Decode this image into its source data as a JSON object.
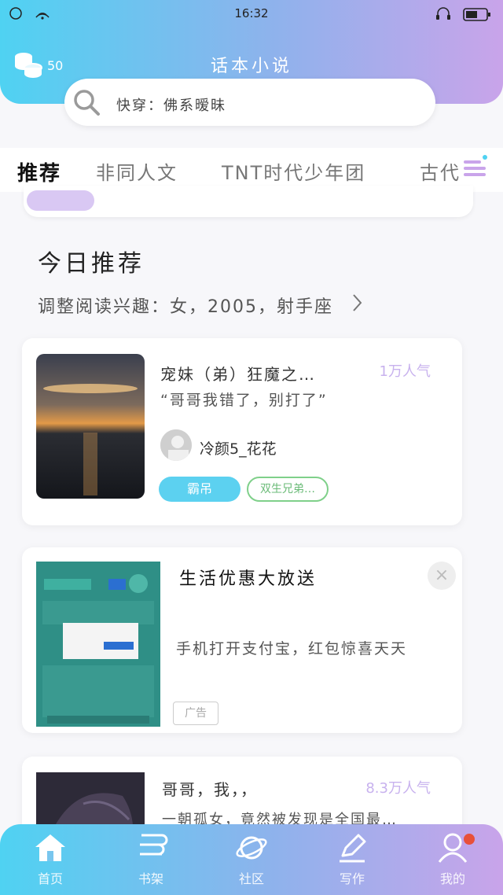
{
  "status_bar": {
    "time": "16:32"
  },
  "header": {
    "coin_count": "50",
    "app_title": "话本小说",
    "search_value": "快穿：佛系暧昧"
  },
  "tabs": [
    {
      "label": "推荐",
      "active": true
    },
    {
      "label": "非同人文",
      "active": false
    },
    {
      "label": "TNT时代少年团",
      "active": false
    },
    {
      "label": "古代",
      "active": false
    }
  ],
  "section": {
    "title": "今日推荐",
    "preference": "调整阅读兴趣：女，2005，射手座"
  },
  "books": [
    {
      "title": "宠妹（弟）狂魔之…",
      "popularity": "1万人气",
      "quote": "“哥哥我错了，别打了”",
      "author": "冷颜5_花花",
      "tags": [
        "霸吊",
        "双生兄弟…"
      ]
    }
  ],
  "ad": {
    "title": "生活优惠大放送",
    "description": "手机打开支付宝，红包惊喜天天",
    "badge": "广告",
    "close_label": "×"
  },
  "partial_book": {
    "title": "哥哥，我，，",
    "popularity": "8.3万人气",
    "desc": "一朝孤女，竟然被发现是全国最…"
  },
  "bottom_nav": [
    {
      "label": "首页",
      "icon": "home-icon",
      "active": true
    },
    {
      "label": "书架",
      "icon": "bookshelf-icon",
      "active": false
    },
    {
      "label": "社区",
      "icon": "planet-icon",
      "active": false
    },
    {
      "label": "写作",
      "icon": "pen-icon",
      "active": false
    },
    {
      "label": "我的",
      "icon": "profile-icon",
      "active": false,
      "badge_dot": true
    }
  ],
  "colors": {
    "gradient_start": "#4fd2f2",
    "gradient_end": "#c9a4ea",
    "accent_cyan": "#5cd1f0",
    "accent_purple": "#c8b2ee"
  }
}
